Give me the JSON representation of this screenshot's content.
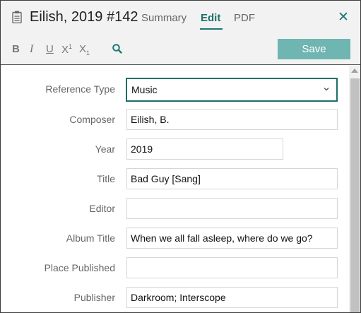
{
  "header": {
    "title": "Eilish, 2019 #142",
    "tabs": [
      {
        "label": "Summary"
      },
      {
        "label": "Edit"
      },
      {
        "label": "PDF"
      }
    ],
    "close_glyph": "✕",
    "icons": {
      "reference": "clipboard-icon",
      "close": "close-icon",
      "search": "search-icon"
    }
  },
  "toolbar": {
    "bold": "B",
    "italic": "I",
    "underline": "U",
    "superscript_base": "X",
    "superscript_mark": "1",
    "subscript_base": "X",
    "subscript_mark": "1",
    "save_label": "Save"
  },
  "form": {
    "fields": [
      {
        "label": "Reference Type",
        "value": "Music"
      },
      {
        "label": "Composer",
        "value": "Eilish, B."
      },
      {
        "label": "Year",
        "value": "2019"
      },
      {
        "label": "Title",
        "value": "Bad Guy [Sang]"
      },
      {
        "label": "Editor",
        "value": ""
      },
      {
        "label": "Album Title",
        "value": "When we all fall asleep, where do we go?"
      },
      {
        "label": "Place Published",
        "value": ""
      },
      {
        "label": "Publisher",
        "value": "Darkroom; Interscope"
      }
    ]
  },
  "colors": {
    "accent": "#1d7872",
    "save_button": "#6fb5b2",
    "header_bg": "#f2f2f2"
  }
}
